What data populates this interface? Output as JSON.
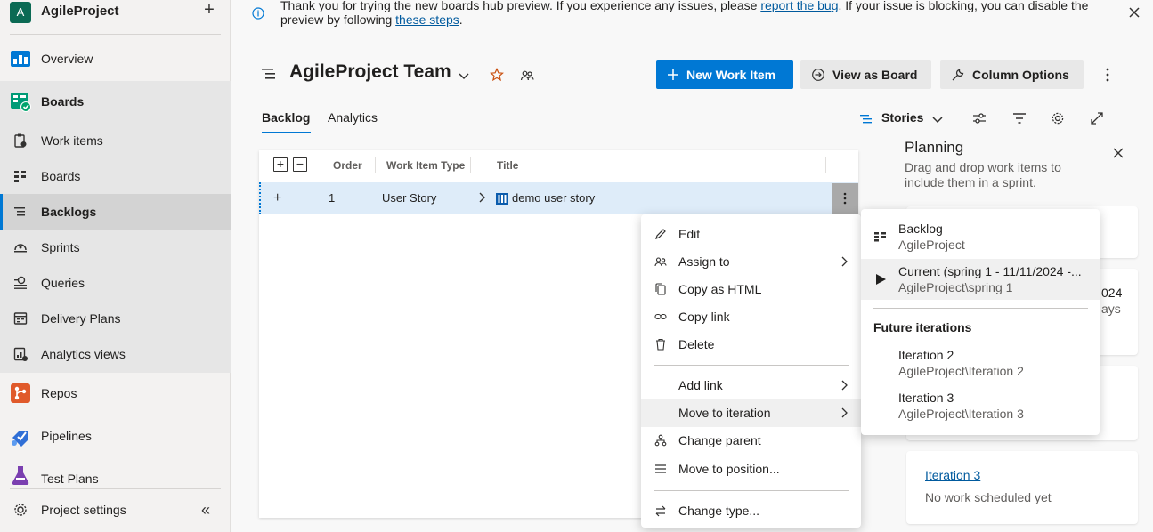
{
  "org": {
    "avatar": "A",
    "name": "AgileProject",
    "add": "+"
  },
  "sidebar": {
    "items": [
      {
        "label": "Overview"
      },
      {
        "label": "Boards"
      },
      {
        "label": "Work items"
      },
      {
        "label": "Boards"
      },
      {
        "label": "Backlogs"
      },
      {
        "label": "Sprints"
      },
      {
        "label": "Queries"
      },
      {
        "label": "Delivery Plans"
      },
      {
        "label": "Analytics views"
      },
      {
        "label": "Repos"
      },
      {
        "label": "Pipelines"
      },
      {
        "label": "Test Plans"
      }
    ],
    "settings": "Project settings",
    "collapse": "«"
  },
  "banner": {
    "text_before": "Thank you for trying the new boards hub preview. If you experience any issues, please ",
    "link1": "report the bug",
    "text_middle": ". If your issue is blocking, you can disable the preview by following ",
    "link2": "these steps",
    "text_after": "."
  },
  "header": {
    "title": "AgileProject Team",
    "new_item": "New Work Item",
    "view_board": "View as Board",
    "column_options": "Column Options"
  },
  "tabs": {
    "backlog": "Backlog",
    "analytics": "Analytics"
  },
  "toolbar": {
    "level": "Stories"
  },
  "grid": {
    "columns": {
      "order": "Order",
      "type": "Work Item Type",
      "title": "Title"
    },
    "expand_all": "+",
    "collapse_all": "−",
    "rows": [
      {
        "add": "+",
        "order": "1",
        "type": "User Story",
        "title": "demo user story"
      }
    ]
  },
  "planning": {
    "title": "Planning",
    "description": "Drag and drop work items to include them in a sprint.",
    "card2_fragment1": "024",
    "card2_fragment2": "ays",
    "card4_link": "Iteration 3",
    "card4_empty": "No work scheduled yet"
  },
  "context_menu": {
    "items": [
      {
        "label": "Edit"
      },
      {
        "label": "Assign to"
      },
      {
        "label": "Copy as HTML"
      },
      {
        "label": "Copy link"
      },
      {
        "label": "Delete"
      },
      {
        "label": "Add link"
      },
      {
        "label": "Move to iteration"
      },
      {
        "label": "Change parent"
      },
      {
        "label": "Move to position..."
      },
      {
        "label": "Change type..."
      }
    ]
  },
  "submenu": {
    "backlog": {
      "title": "Backlog",
      "path": "AgileProject"
    },
    "current": {
      "title": "Current (spring 1 - 11/11/2024 -...",
      "path": "AgileProject\\spring 1"
    },
    "future_header": "Future iterations",
    "future": [
      {
        "title": "Iteration 2",
        "path": "AgileProject\\Iteration 2"
      },
      {
        "title": "Iteration 3",
        "path": "AgileProject\\Iteration 3"
      }
    ]
  }
}
